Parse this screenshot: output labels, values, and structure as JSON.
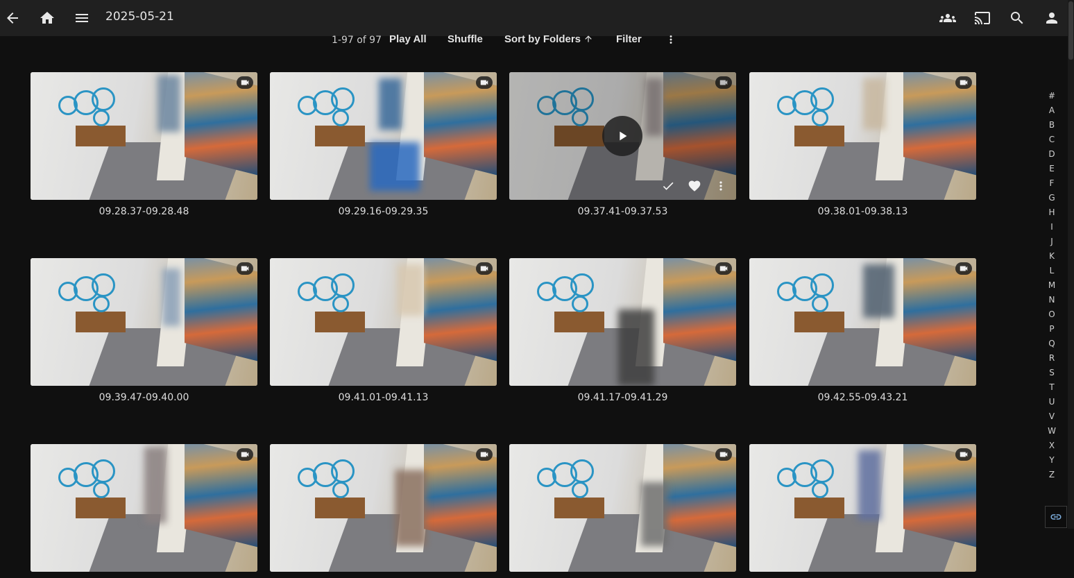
{
  "header": {
    "title": "2025-05-21",
    "icons": [
      "back-arrow-icon",
      "home-icon",
      "menu-icon",
      "users-icon",
      "cast-icon",
      "search-icon",
      "user-icon"
    ]
  },
  "toolbar": {
    "count": "1-97 of 97",
    "play_all": "Play All",
    "shuffle": "Shuffle",
    "sort": "Sort by Folders",
    "filter": "Filter"
  },
  "grid": {
    "items": [
      {
        "caption": "09.28.37-09.28.48"
      },
      {
        "caption": "09.29.16-09.29.35"
      },
      {
        "caption": "09.37.41-09.37.53"
      },
      {
        "caption": "09.38.01-09.38.13"
      },
      {
        "caption": "09.39.47-09.40.00"
      },
      {
        "caption": "09.41.01-09.41.13"
      },
      {
        "caption": "09.41.17-09.41.29"
      },
      {
        "caption": "09.42.55-09.43.21"
      },
      {
        "caption": ""
      },
      {
        "caption": ""
      },
      {
        "caption": ""
      },
      {
        "caption": ""
      }
    ]
  },
  "alphabet": [
    "#",
    "A",
    "B",
    "C",
    "D",
    "E",
    "F",
    "G",
    "H",
    "I",
    "J",
    "K",
    "L",
    "M",
    "N",
    "O",
    "P",
    "Q",
    "R",
    "S",
    "T",
    "U",
    "V",
    "W",
    "X",
    "Y",
    "Z"
  ],
  "colors": {
    "background": "#101010",
    "topbar": "#202020",
    "accent_ring": "#2a94c4"
  }
}
